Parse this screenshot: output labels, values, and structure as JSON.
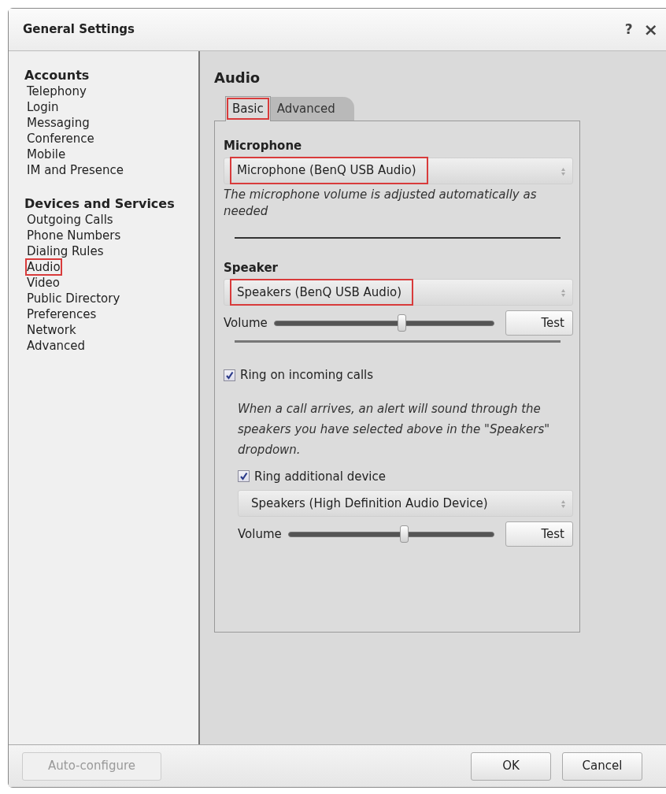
{
  "window": {
    "title": "General Settings",
    "help": "?",
    "close": "×"
  },
  "sidebar": {
    "groups": [
      {
        "heading": "Accounts",
        "items": [
          {
            "label": "Telephony",
            "highlighted": false
          },
          {
            "label": "Login",
            "highlighted": false
          },
          {
            "label": "Messaging",
            "highlighted": false
          },
          {
            "label": "Conference",
            "highlighted": false
          },
          {
            "label": "Mobile",
            "highlighted": false
          },
          {
            "label": "IM and Presence",
            "highlighted": false
          }
        ]
      },
      {
        "heading": "Devices and Services",
        "items": [
          {
            "label": "Outgoing Calls",
            "highlighted": false
          },
          {
            "label": "Phone Numbers",
            "highlighted": false
          },
          {
            "label": "Dialing Rules",
            "highlighted": false
          },
          {
            "label": "Audio",
            "highlighted": true
          },
          {
            "label": "Video",
            "highlighted": false
          },
          {
            "label": "Public Directory",
            "highlighted": false
          },
          {
            "label": "Preferences",
            "highlighted": false
          },
          {
            "label": "Network",
            "highlighted": false
          },
          {
            "label": "Advanced",
            "highlighted": false
          }
        ]
      }
    ]
  },
  "content": {
    "title": "Audio",
    "tabs": [
      {
        "label": "Basic",
        "selected": true,
        "highlighted": true
      },
      {
        "label": "Advanced",
        "selected": false,
        "highlighted": false
      }
    ],
    "microphone": {
      "heading": "Microphone",
      "dropdown": {
        "value": "Microphone (BenQ USB Audio)",
        "highlighted": true
      },
      "note": "The microphone volume is adjusted automatically as needed"
    },
    "speaker": {
      "heading": "Speaker",
      "dropdown": {
        "value": "Speakers (BenQ USB Audio)",
        "highlighted": true
      },
      "volume_label": "Volume",
      "volume": {
        "level": 0.58
      },
      "test_button": "Test"
    },
    "ring": {
      "label": "Ring on incoming calls",
      "checked": true,
      "note": "When a call arrives, an alert will sound through the speakers you have selected above in the \"Speakers\" dropdown.",
      "additional": {
        "label": "Ring additional device",
        "checked": true,
        "dropdown": {
          "value": "Speakers (High Definition Audio Device)",
          "highlighted": false
        },
        "volume_label": "Volume",
        "volume": {
          "level": 0.56
        },
        "test_button": "Test"
      }
    }
  },
  "footer": {
    "buttons": [
      {
        "label": "Auto-configure",
        "disabled": true
      },
      {
        "label": "OK",
        "disabled": false
      },
      {
        "label": "Cancel",
        "disabled": false
      }
    ]
  }
}
